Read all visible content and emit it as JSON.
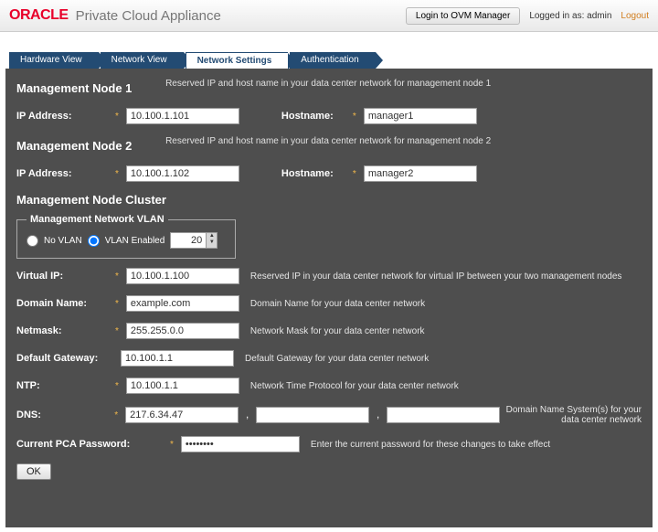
{
  "header": {
    "brand": "ORACLE",
    "product": "Private Cloud Appliance",
    "ovm_button": "Login to OVM Manager",
    "logged_in_prefix": "Logged in as:",
    "logged_in_user": "admin",
    "logout": "Logout"
  },
  "tabs": {
    "hardware": "Hardware View",
    "network": "Network View",
    "settings": "Network Settings",
    "auth": "Authentication"
  },
  "node1": {
    "title": "Management Node 1",
    "desc": "Reserved IP and host name in your data center network for management node 1",
    "ip_label": "IP Address:",
    "ip_value": "10.100.1.101",
    "hostname_label": "Hostname:",
    "hostname_value": "manager1"
  },
  "node2": {
    "title": "Management Node 2",
    "desc": "Reserved IP and host name in your data center network for management node 2",
    "ip_label": "IP Address:",
    "ip_value": "10.100.1.102",
    "hostname_label": "Hostname:",
    "hostname_value": "manager2"
  },
  "cluster": {
    "title": "Management Node Cluster",
    "vlan_legend": "Management Network VLAN",
    "no_vlan_label": "No VLAN",
    "vlan_enabled_label": "VLAN Enabled",
    "vlan_value": "20"
  },
  "fields": {
    "virtual_ip": {
      "label": "Virtual IP:",
      "value": "10.100.1.100",
      "desc": "Reserved IP in your data center network for virtual IP between your two management nodes"
    },
    "domain": {
      "label": "Domain Name:",
      "value": "example.com",
      "desc": "Domain Name for your data center network"
    },
    "netmask": {
      "label": "Netmask:",
      "value": "255.255.0.0",
      "desc": "Network Mask for your data center network"
    },
    "gateway": {
      "label": "Default Gateway:",
      "value": "10.100.1.1",
      "desc": "Default Gateway for your data center network"
    },
    "ntp": {
      "label": "NTP:",
      "value": "10.100.1.1",
      "desc": "Network Time Protocol for your data center network"
    },
    "dns": {
      "label": "DNS:",
      "value1": "217.6.34.47",
      "value2": "",
      "value3": "",
      "desc": "Domain Name System(s) for your data center network"
    },
    "password": {
      "label": "Current PCA Password:",
      "value": "••••••••",
      "desc": "Enter the current password for these changes to take effect"
    }
  },
  "ok_button": "OK"
}
